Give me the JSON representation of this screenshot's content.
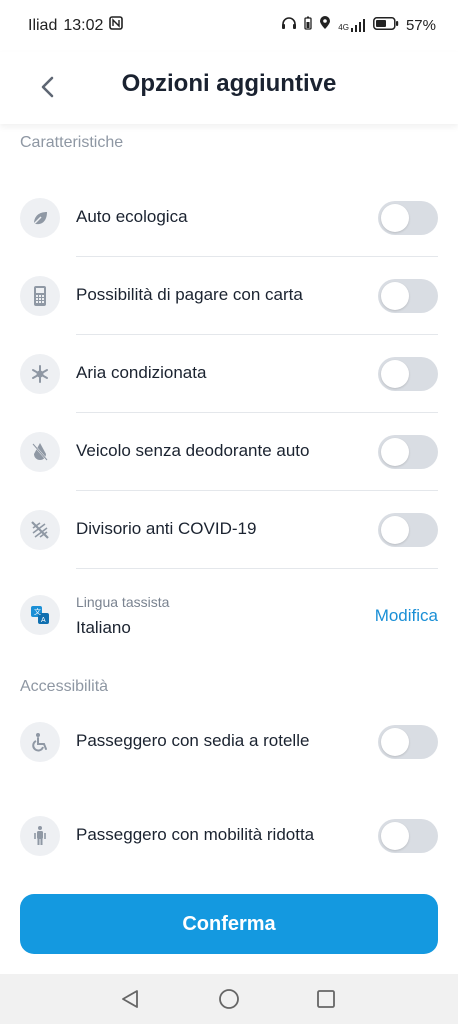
{
  "status_bar": {
    "carrier": "Iliad",
    "time": "13:02",
    "network": "4G",
    "battery": "57%"
  },
  "header": {
    "title": "Opzioni aggiuntive"
  },
  "sections": {
    "features_title": "Caratteristiche",
    "accessibility_title": "Accessibilità"
  },
  "features": [
    {
      "label": "Auto ecologica",
      "icon": "leaf-icon",
      "enabled": false
    },
    {
      "label": "Possibilità di pagare con carta",
      "icon": "card-terminal-icon",
      "enabled": false
    },
    {
      "label": "Aria condizionata",
      "icon": "snowflake-icon",
      "enabled": false
    },
    {
      "label": "Veicolo senza deodorante auto",
      "icon": "air-freshener-off-icon",
      "enabled": false
    },
    {
      "label": "Divisorio anti COVID-19",
      "icon": "divider-off-icon",
      "enabled": false
    }
  ],
  "language": {
    "subtitle": "Lingua tassista",
    "value": "Italiano",
    "action": "Modifica",
    "icon": "translate-icon"
  },
  "accessibility": [
    {
      "label": "Passeggero con sedia a rotelle",
      "icon": "wheelchair-icon",
      "enabled": false
    },
    {
      "label": "Passeggero con mobilità ridotta",
      "icon": "person-reduced-mobility-icon",
      "enabled": false
    }
  ],
  "confirm_button": {
    "label": "Conferma"
  },
  "colors": {
    "accent": "#1499e0",
    "link": "#1a8fd6",
    "toggle_off": "#d9dde3",
    "section_title": "#8e97a3"
  }
}
